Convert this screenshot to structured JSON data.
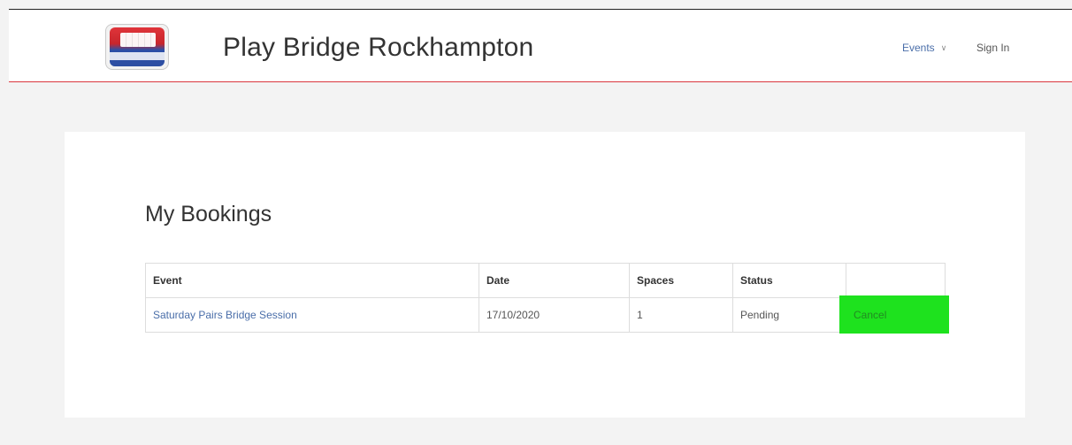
{
  "header": {
    "site_title": "Play Bridge Rockhampton",
    "nav": {
      "events_label": "Events",
      "events_chevron": "∨",
      "signin_label": "Sign In"
    }
  },
  "main": {
    "page_title": "My Bookings",
    "table": {
      "columns": [
        "Event",
        "Date",
        "Spaces",
        "Status",
        ""
      ],
      "rows": [
        {
          "event": "Saturday Pairs Bridge Session",
          "date": "17/10/2020",
          "spaces": "1",
          "status": "Pending",
          "action_label": "Cancel"
        }
      ]
    }
  },
  "colors": {
    "accent_red": "#d9363e",
    "link_blue": "#4a6ea9",
    "cancel_green": "#1ee21e"
  }
}
